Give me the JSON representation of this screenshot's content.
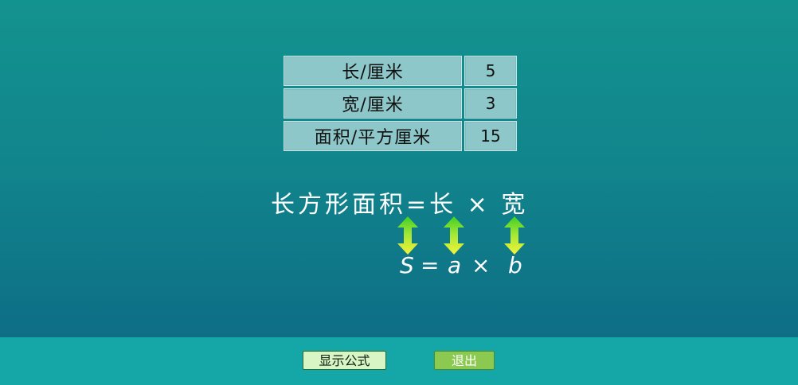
{
  "table": {
    "rows": [
      {
        "label": "长/厘米",
        "value": "5"
      },
      {
        "label": "宽/厘米",
        "value": "3"
      },
      {
        "label": "面积/平方厘米",
        "value": "15"
      }
    ]
  },
  "formula": {
    "text": "长方形面积=长 × 宽",
    "symbols": {
      "s": "S",
      "eq": "=",
      "a": "a",
      "times": "×",
      "b": "b"
    }
  },
  "arrows": {
    "color_top": "#4fd62e",
    "color_bottom": "#f0f03a",
    "icon": "double-vertical-arrow"
  },
  "buttons": {
    "show_formula": "显示公式",
    "exit": "退出"
  },
  "colors": {
    "background_top": "#13938f",
    "background_bottom": "#0d6b84",
    "bottom_bar": "#15a7a8",
    "table_cell": "#8dc7c9",
    "show_button": "#d8f5c6",
    "exit_button": "#8cc950"
  }
}
